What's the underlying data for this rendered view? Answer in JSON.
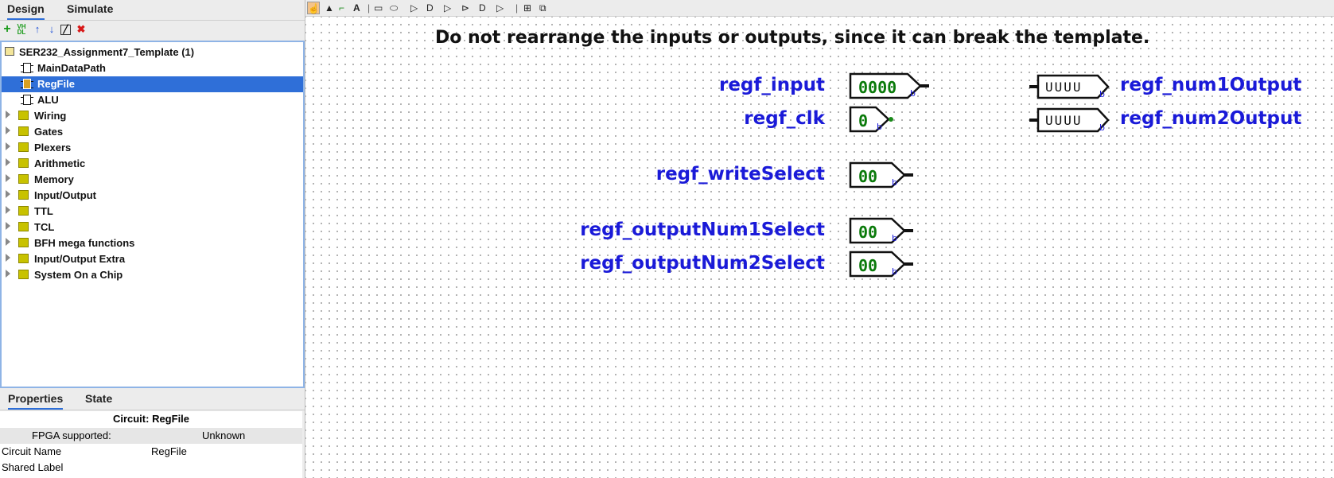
{
  "tabs": {
    "design": "Design",
    "simulate": "Simulate"
  },
  "left_toolbar": [
    "add-icon",
    "vhdl-icon",
    "move-up-icon",
    "move-down-icon",
    "edit-appearance-icon",
    "delete-icon"
  ],
  "tree": {
    "project": "SER232_Assignment7_Template (1)",
    "circuits": [
      "MainDataPath",
      "RegFile",
      "ALU"
    ],
    "selected": "RegFile",
    "libraries": [
      "Wiring",
      "Gates",
      "Plexers",
      "Arithmetic",
      "Memory",
      "Input/Output",
      "TTL",
      "TCL",
      "BFH mega functions",
      "Input/Output Extra",
      "System On a Chip"
    ]
  },
  "props_tabs": {
    "properties": "Properties",
    "state": "State"
  },
  "props": {
    "title": "Circuit: RegFile",
    "fpga_label": "FPGA supported:",
    "fpga_value": "Unknown",
    "name_label": "Circuit Name",
    "name_value": "RegFile",
    "shared_label": "Shared Label"
  },
  "canvas": {
    "note": "Do not rearrange the inputs or outputs, since it can break the template.",
    "inputs": [
      {
        "label": "regf_input",
        "value": "0000",
        "suffix": "b"
      },
      {
        "label": "regf_clk",
        "value": "0",
        "suffix": "b"
      },
      {
        "label": "regf_writeSelect",
        "value": "00",
        "suffix": "b"
      },
      {
        "label": "regf_outputNum1Select",
        "value": "00",
        "suffix": "b"
      },
      {
        "label": "regf_outputNum2Select",
        "value": "00",
        "suffix": "b"
      }
    ],
    "outputs": [
      {
        "label": "regf_num1Output",
        "value": "UUUU",
        "suffix": "b"
      },
      {
        "label": "regf_num2Output",
        "value": "UUUU",
        "suffix": "b"
      }
    ]
  },
  "colors": {
    "accent": "#2f6fd8",
    "pin_label": "#1a1ad8",
    "pin_value": "#0a7a0a"
  }
}
